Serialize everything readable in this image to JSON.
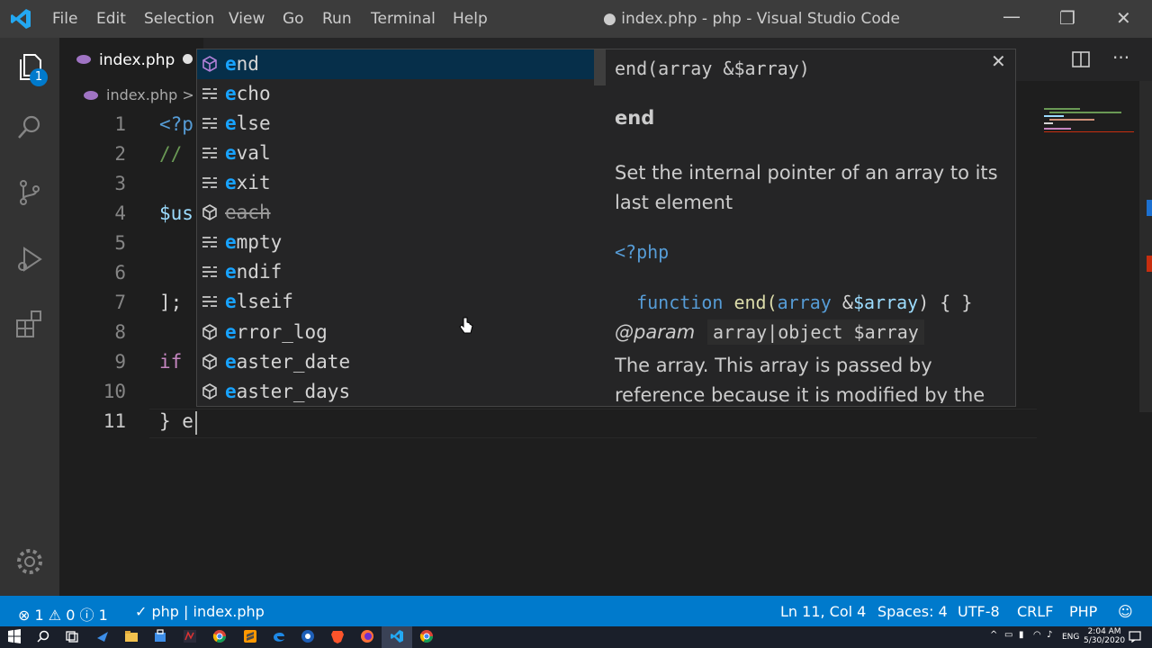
{
  "window": {
    "title": "● index.php - php - Visual Studio Code"
  },
  "menu": [
    "File",
    "Edit",
    "Selection",
    "View",
    "Go",
    "Run",
    "Terminal",
    "Help"
  ],
  "tab": {
    "label": "index.php"
  },
  "breadcrumb": {
    "file": "index.php",
    "sep": ">"
  },
  "explorer_badge": "1",
  "editor": {
    "line_numbers": [
      "1",
      "2",
      "3",
      "4",
      "5",
      "6",
      "7",
      "8",
      "9",
      "10",
      "11"
    ],
    "lines": [
      "<?p",
      "//",
      "",
      "$us",
      "",
      "",
      "];",
      "",
      "if",
      "",
      "} e"
    ]
  },
  "suggest": {
    "items": [
      {
        "hl": "e",
        "rest": "nd",
        "kind": "function",
        "deprecated": false
      },
      {
        "hl": "e",
        "rest": "cho",
        "kind": "keyword",
        "deprecated": false
      },
      {
        "hl": "e",
        "rest": "lse",
        "kind": "keyword",
        "deprecated": false
      },
      {
        "hl": "e",
        "rest": "val",
        "kind": "keyword",
        "deprecated": false
      },
      {
        "hl": "e",
        "rest": "xit",
        "kind": "keyword",
        "deprecated": false
      },
      {
        "hl": "e",
        "rest": "ach",
        "kind": "function",
        "deprecated": true
      },
      {
        "hl": "e",
        "rest": "mpty",
        "kind": "keyword",
        "deprecated": false
      },
      {
        "hl": "e",
        "rest": "ndif",
        "kind": "keyword",
        "deprecated": false
      },
      {
        "hl": "e",
        "rest": "lseif",
        "kind": "keyword",
        "deprecated": false
      },
      {
        "hl": "e",
        "rest": "rror_log",
        "kind": "function",
        "deprecated": false
      },
      {
        "hl": "e",
        "rest": "aster_date",
        "kind": "function",
        "deprecated": false
      },
      {
        "hl": "e",
        "rest": "aster_days",
        "kind": "function",
        "deprecated": false
      }
    ]
  },
  "details": {
    "signature": "end(array &$array)",
    "name": "end",
    "description": "Set the internal pointer of an array to its last element",
    "code_open": "<?php",
    "code_fn_kw": "function",
    "code_fn_name": "end(",
    "code_type": "array",
    "code_amp": " &",
    "code_var": "$array",
    "code_close": ") { }",
    "param_tag": "@param",
    "param_type": "array|object $array",
    "param_desc": "The array. This array is passed by reference because it is modified by the"
  },
  "status": {
    "errors": "1",
    "warnings": "0",
    "infos": "1",
    "php_check": "php | index.php",
    "position": "Ln 11, Col 4",
    "spaces": "Spaces: 4",
    "encoding": "UTF-8",
    "eol": "CRLF",
    "language": "PHP"
  },
  "tray": {
    "lang": "ENG",
    "time": "2:04 AM",
    "date": "5/30/2020"
  },
  "colors": {
    "accent": "#007acc",
    "highlight": "#18a3ff",
    "selection": "#062f4a",
    "function_icon": "#b180d7"
  }
}
